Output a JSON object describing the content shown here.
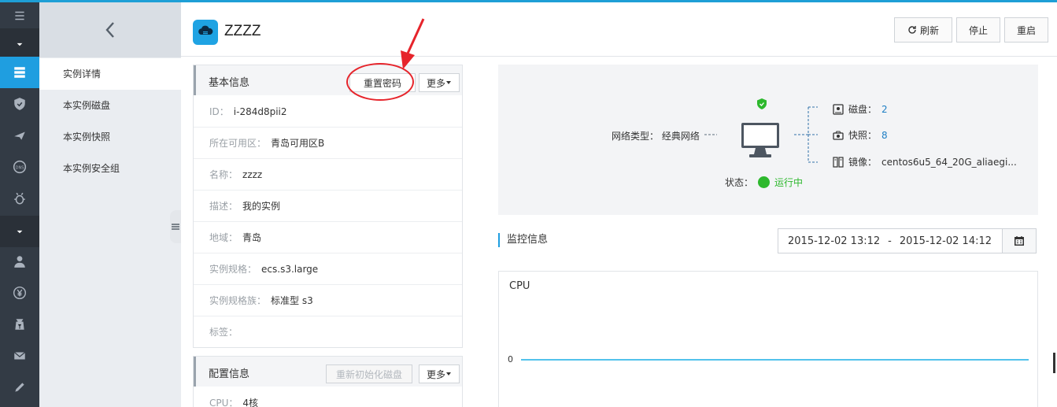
{
  "sidebar": {
    "icons": [
      "menu-icon",
      "caret-down-icon",
      "server-list-icon",
      "shield-icon",
      "plane-icon",
      "dns-icon",
      "bug-icon",
      "caret-down-icon",
      "user-icon",
      "yen-icon",
      "money-icon",
      "mail-icon",
      "pencil-icon"
    ]
  },
  "subnav": {
    "items": [
      {
        "label": "实例详情"
      },
      {
        "label": "本实例磁盘"
      },
      {
        "label": "本实例快照"
      },
      {
        "label": "本实例安全组"
      }
    ]
  },
  "header": {
    "title": "ZZZZ",
    "buttons": {
      "refresh": "刷新",
      "stop": "停止",
      "restart": "重启"
    }
  },
  "basic_info": {
    "title": "基本信息",
    "reset_password": "重置密码",
    "more": "更多",
    "rows": [
      {
        "key": "ID：",
        "value": "i-284d8pii2"
      },
      {
        "key": "所在可用区：",
        "value": "青岛可用区B"
      },
      {
        "key": "名称：",
        "value": "zzzz"
      },
      {
        "key": "描述：",
        "value": "我的实例"
      },
      {
        "key": "地域：",
        "value": "青岛"
      },
      {
        "key": "实例规格：",
        "value": "ecs.s3.large"
      },
      {
        "key": "实例规格族：",
        "value": "标准型 s3"
      },
      {
        "key": "标签：",
        "value": ""
      }
    ]
  },
  "config_info": {
    "title": "配置信息",
    "reinit_disk": "重新初始化磁盘",
    "more": "更多",
    "rows": [
      {
        "key": "CPU：",
        "value": "4核"
      }
    ]
  },
  "topology": {
    "network_label": "网络类型：",
    "network_value": "经典网络",
    "disk_label": "磁盘：",
    "disk_value": "2",
    "snapshot_label": "快照：",
    "snapshot_value": "8",
    "image_label": "镜像：",
    "image_value": "centos6u5_64_20G_aliaegi...",
    "status_label": "状态：",
    "status_value": "运行中"
  },
  "monitor": {
    "title": "监控信息",
    "start": "2015-12-02 13:12",
    "separator": "-",
    "end": "2015-12-02 14:12"
  },
  "chart": {
    "title": "CPU",
    "y_tick": "0"
  },
  "colors": {
    "accent": "#1f9ee0",
    "status_green": "#2db82d",
    "annotation_red": "#e6242b",
    "line": "#52c2ec"
  }
}
